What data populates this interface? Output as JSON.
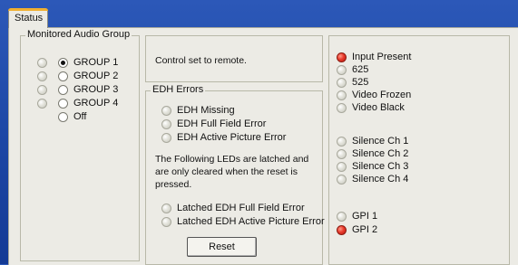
{
  "tab": {
    "label": "Status"
  },
  "audio_group": {
    "title": "Monitored Audio Group",
    "options": [
      {
        "label": "GROUP 1",
        "selected": true,
        "led": "off"
      },
      {
        "label": "GROUP 2",
        "selected": false,
        "led": "off"
      },
      {
        "label": "GROUP 3",
        "selected": false,
        "led": "off"
      },
      {
        "label": "GROUP 4",
        "selected": false,
        "led": "off"
      },
      {
        "label": "Off",
        "selected": false
      }
    ]
  },
  "control": {
    "message": "Control set to remote."
  },
  "edh": {
    "title": "EDH Errors",
    "leds": [
      {
        "label": "EDH Missing",
        "state": "off"
      },
      {
        "label": "EDH Full Field Error",
        "state": "off"
      },
      {
        "label": "EDH Active Picture Error",
        "state": "off"
      }
    ],
    "note": "The Following LEDs are latched and are only cleared when the reset is pressed.",
    "latched": [
      {
        "label": "Latched EDH Full Field Error",
        "state": "off"
      },
      {
        "label": "Latched EDH Active Picture Error",
        "state": "off"
      }
    ],
    "reset_label": "Reset"
  },
  "status": {
    "video": [
      {
        "label": "Input Present",
        "state": "on"
      },
      {
        "label": "625",
        "state": "off"
      },
      {
        "label": "525",
        "state": "off"
      },
      {
        "label": "Video Frozen",
        "state": "off"
      },
      {
        "label": "Video Black",
        "state": "off"
      }
    ],
    "silence": [
      {
        "label": "Silence Ch 1",
        "state": "off"
      },
      {
        "label": "Silence Ch 2",
        "state": "off"
      },
      {
        "label": "Silence Ch 3",
        "state": "off"
      },
      {
        "label": "Silence Ch 4",
        "state": "off"
      }
    ],
    "gpi": [
      {
        "label": "GPI 1",
        "state": "off"
      },
      {
        "label": "GPI 2",
        "state": "on"
      }
    ]
  },
  "colors": {
    "led_on": "#e83a2c",
    "led_off": "#e2e2da",
    "panel": "#ecebe5",
    "desktop": "#1d47a6"
  }
}
